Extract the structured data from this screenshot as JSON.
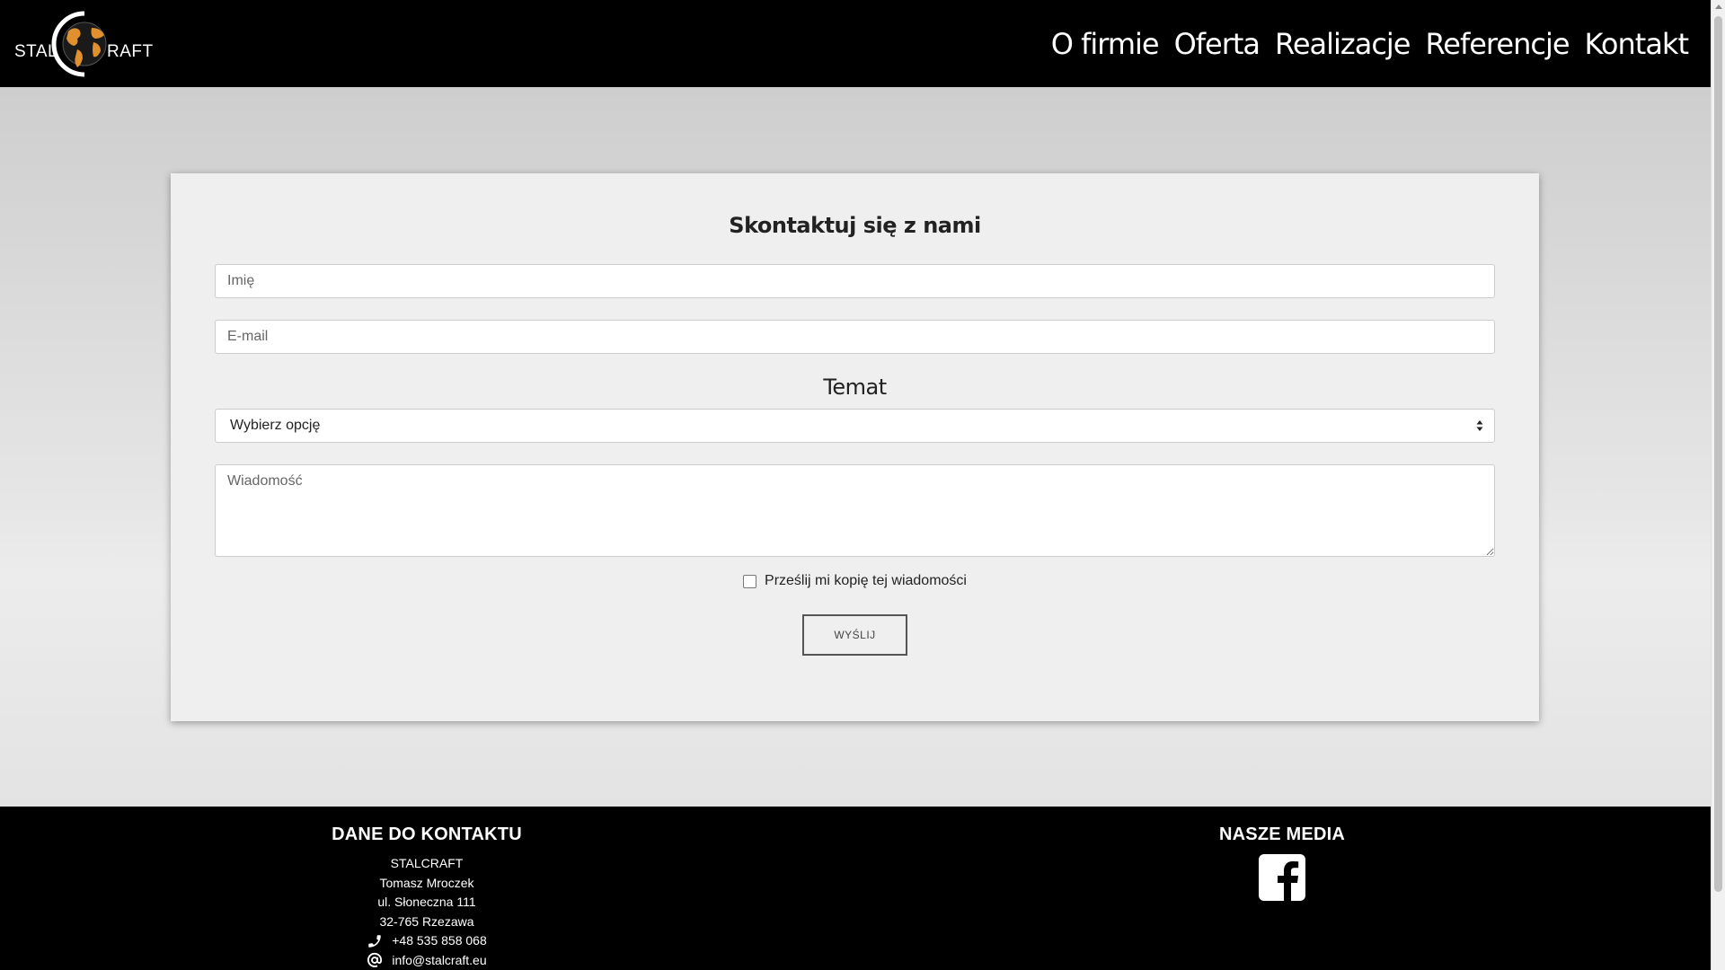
{
  "header": {
    "logo_left": "STAL",
    "logo_right": "RAFT",
    "nav": [
      "O firmie",
      "Oferta",
      "Realizacje",
      "Referencje",
      "Kontakt"
    ]
  },
  "form": {
    "title": "Skontaktuj się z nami",
    "name_placeholder": "Imię",
    "email_placeholder": "E-mail",
    "topic_label": "Temat",
    "topic_selected": "Wybierz opcję",
    "message_placeholder": "Wiadomość",
    "copy_label": "Prześlij mi kopię tej wiadomości",
    "send_label": "WYŚLIJ"
  },
  "footer": {
    "contact_title": "DANE DO KONTAKTU",
    "company": "STALCRAFT",
    "person": "Tomasz Mroczek",
    "street": "ul. Słoneczna 111",
    "city": "32-765 Rzezawa",
    "phone": "+48 535 858 068",
    "email": "info@stalcraft.eu",
    "media_title": "NASZE MEDIA"
  },
  "icons": {
    "phone": "phone-icon",
    "email": "at-icon",
    "facebook": "facebook-icon"
  },
  "colors": {
    "header_bg": "#000000",
    "card_bg": "#efefef",
    "logo_accent": "#e0902e"
  }
}
